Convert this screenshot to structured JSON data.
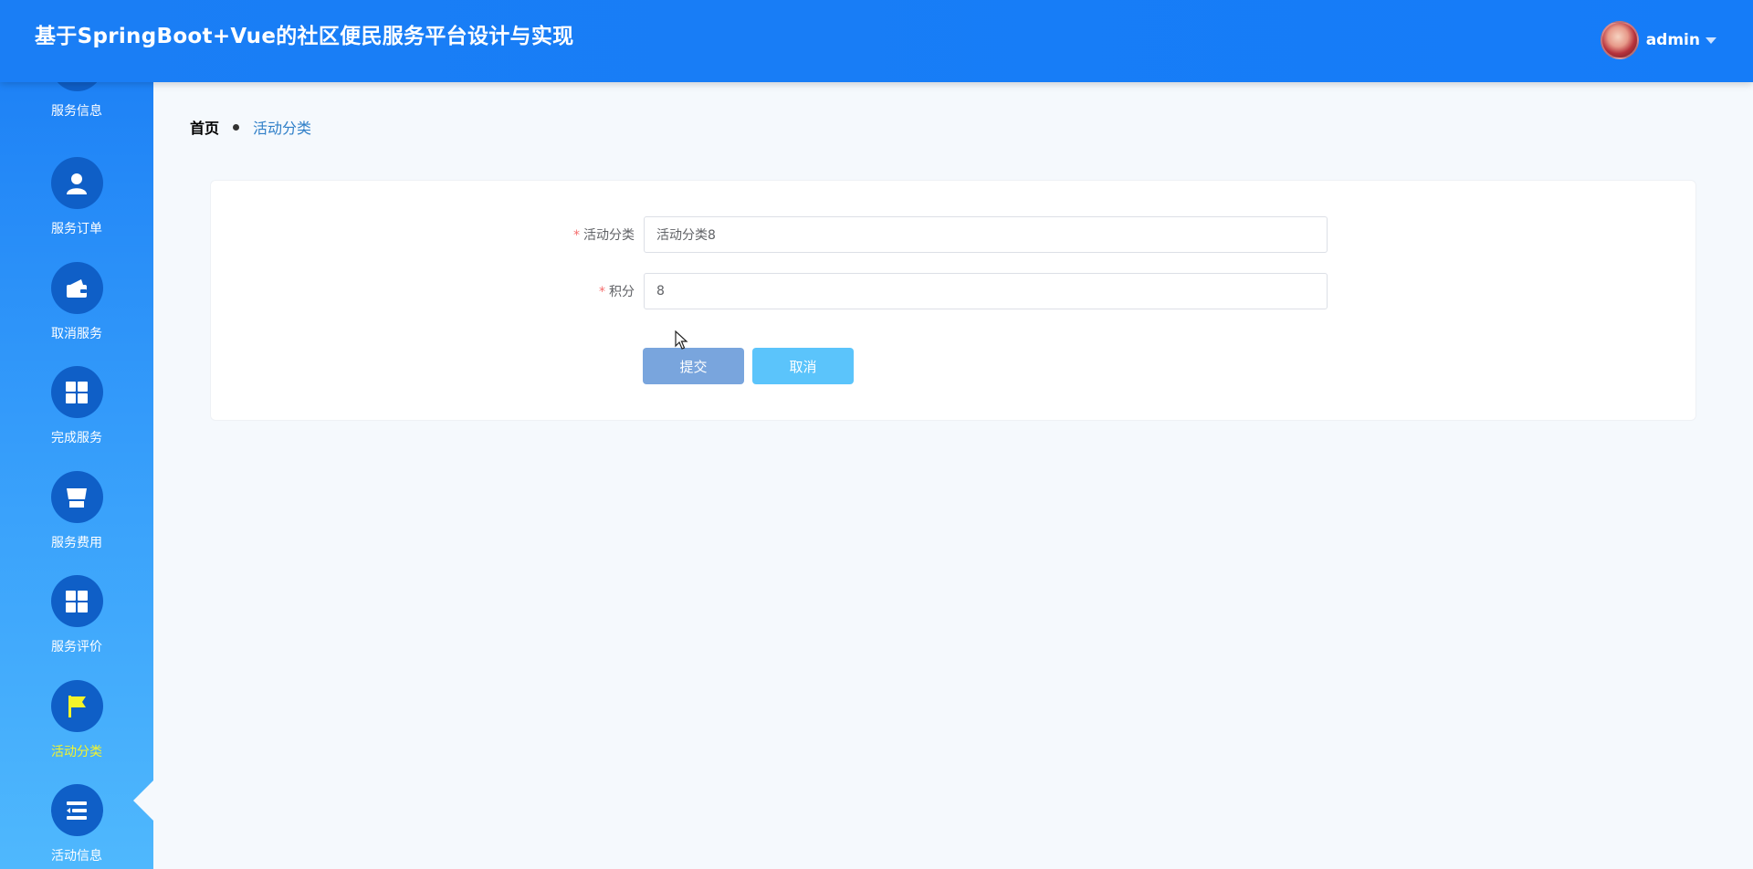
{
  "header": {
    "title": "基于SpringBoot+Vue的社区便民服务平台设计与实现",
    "username": "admin"
  },
  "sidebar": {
    "items": [
      {
        "label": "服务信息",
        "icon": "info-icon"
      },
      {
        "label": "服务订单",
        "icon": "user-icon"
      },
      {
        "label": "取消服务",
        "icon": "wallet-icon"
      },
      {
        "label": "完成服务",
        "icon": "grid-icon"
      },
      {
        "label": "服务费用",
        "icon": "shop-icon"
      },
      {
        "label": "服务评价",
        "icon": "grid-icon"
      },
      {
        "label": "活动分类",
        "icon": "flag-icon",
        "active": true
      },
      {
        "label": "活动信息",
        "icon": "list-icon"
      }
    ]
  },
  "breadcrumb": {
    "home": "首页",
    "current": "活动分类"
  },
  "form": {
    "category_label": "活动分类",
    "category_value": "活动分类8",
    "points_label": "积分",
    "points_value": "8",
    "required_mark": "*",
    "submit_label": "提交",
    "cancel_label": "取消"
  },
  "colors": {
    "header": "#157cf8",
    "active_label": "#f4f42a",
    "submit": "#79a5dd",
    "cancel": "#5bc4fb"
  }
}
